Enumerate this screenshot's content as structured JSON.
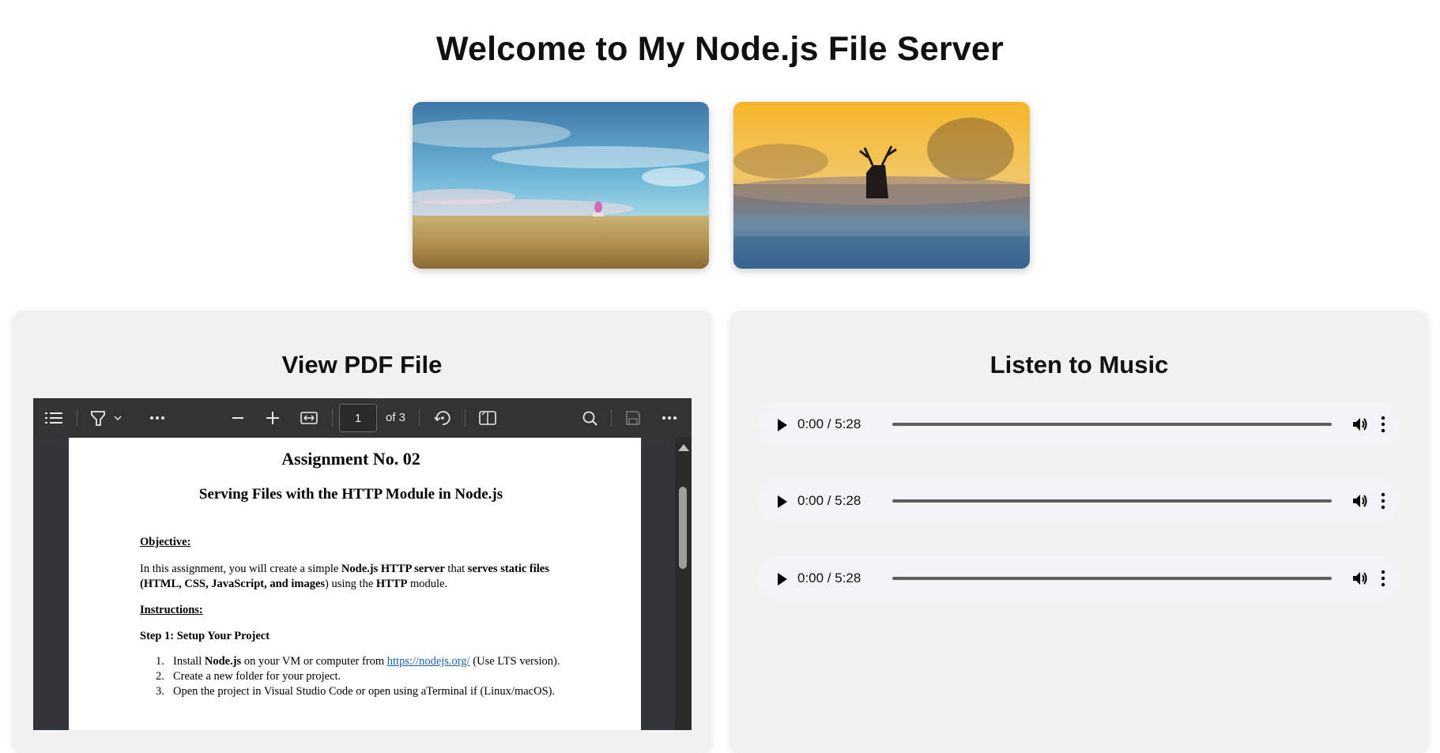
{
  "header": {
    "title": "Welcome to My Node.js File Server"
  },
  "gallery": {
    "images": [
      {
        "icon": "landscape-grassland-sky-image"
      },
      {
        "icon": "deer-sunrise-frost-image"
      }
    ]
  },
  "pdf_panel": {
    "title": "View PDF File",
    "toolbar": {
      "current_page": "1",
      "page_count_label": "of 3",
      "icons": [
        "contents-menu-icon",
        "highlighter-icon",
        "chevron-down-icon",
        "more-horizontal-icon",
        "zoom-out-icon",
        "zoom-in-icon",
        "fit-width-icon",
        "rotate-icon",
        "two-page-view-icon",
        "search-icon",
        "save-icon",
        "more-options-icon"
      ]
    },
    "document": {
      "title": "Assignment No. 02",
      "subtitle": "Serving Files with the HTTP Module in Node.js",
      "objective_heading": "Objective:",
      "objective_parts": {
        "p1": "In this assignment, you will create a simple ",
        "b1": "Node.js HTTP server",
        "p2": " that ",
        "b2": "serves static files",
        "b3": "(HTML, CSS, JavaScript, and images",
        "p3": ") using the ",
        "b4": "HTTP",
        "p4": " module."
      },
      "instructions_heading": "Instructions:",
      "step1_heading": "Step 1: Setup Your Project",
      "steps": [
        {
          "num": "1.",
          "pre": "Install ",
          "bold": "Node.js",
          "mid": " on your VM or computer from ",
          "link": "https://nodejs.org/",
          "post": "  (Use LTS version)."
        },
        {
          "num": "2.",
          "text": "Create a new folder for your project."
        },
        {
          "num": "3.",
          "text": "Open the project in Visual Studio Code or open using aTerminal if (Linux/macOS)."
        }
      ]
    }
  },
  "music_panel": {
    "title": "Listen to Music",
    "players": [
      {
        "time": "0:00 / 5:28",
        "progress": 0
      },
      {
        "time": "0:00 / 5:28",
        "progress": 0
      },
      {
        "time": "0:00 / 5:28",
        "progress": 0
      }
    ]
  }
}
